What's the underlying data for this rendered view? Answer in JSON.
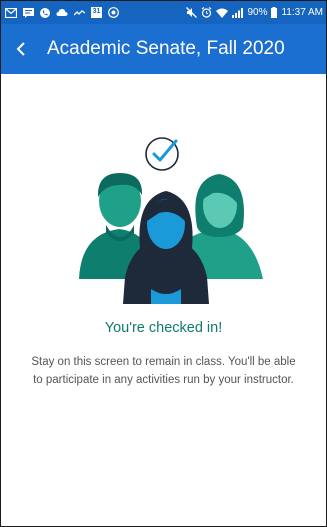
{
  "status_bar": {
    "battery": "90%",
    "time": "11:37 AM",
    "calendar_day": "31"
  },
  "app_bar": {
    "title": "Academic Senate, Fall 2020"
  },
  "main": {
    "checked_in_title": "You're checked in!",
    "checked_in_message": "Stay on this screen to remain in class. You'll be able to participate in any activities run by your instructor."
  },
  "colors": {
    "status_bar_bg": "#1565c0",
    "app_bar_bg": "#1a6fd0",
    "accent_teal": "#0f7b6c",
    "figure_dark": "#1e2a3a",
    "figure_blue": "#1a9ad8"
  },
  "icons": [
    "gmail-icon",
    "message-icon",
    "phone-icon",
    "cloud-icon",
    "calendar-icon",
    "camera-icon",
    "mute-icon",
    "alarm-icon",
    "wifi-icon",
    "signal-icon",
    "battery-icon",
    "back-arrow-icon",
    "checkmark-circle-icon"
  ]
}
